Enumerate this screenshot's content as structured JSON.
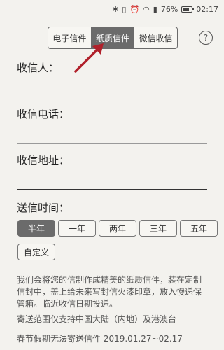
{
  "status": {
    "bluetooth_icon": "bluetooth-icon",
    "vibrate_icon": "vibrate-icon",
    "alarm_icon": "alarm-icon",
    "wifi_icon": "wifi-icon",
    "sim_icon": "sim-icon",
    "battery_percent": "76%",
    "battery_level": 0.76,
    "time": "02:17"
  },
  "tabs": [
    {
      "label": "电子信件",
      "active": false
    },
    {
      "label": "纸质信件",
      "active": true
    },
    {
      "label": "微信收信",
      "active": false
    }
  ],
  "help_label": "?",
  "form": {
    "recipient_label": "收信人：",
    "phone_label": "收信电话：",
    "address_label": "收信地址：",
    "send_time_label": "送信时间："
  },
  "send_time_options": [
    "半年",
    "一年",
    "两年",
    "三年",
    "五年",
    "自定义"
  ],
  "selected_option": "半年",
  "description": "我们会将您的信制作成精美的纸质信件，装在定制信封中，盖上给未来写封信火漆印章，放入慢递保管箱。临近收信日期投递。",
  "scope_note": "寄送范围仅支持中国大陆（内地）及港澳台",
  "holiday_note": "春节假期无法寄送信件 2019.01.27~02.17",
  "colors": {
    "accent": "#6b6b6b",
    "arrow": "#b0202a",
    "background": "#f3f2ee"
  }
}
